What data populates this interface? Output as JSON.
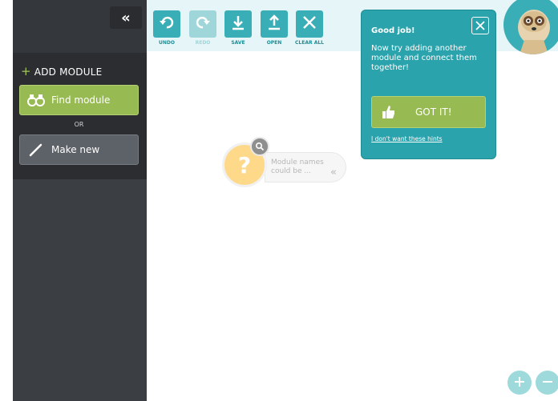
{
  "sidebar": {
    "collapse_icon": "double-chevron-left-icon",
    "add_module_label": "ADD MODULE",
    "find_module_label": "Find module",
    "or_label": "OR",
    "make_new_label": "Make new"
  },
  "toolbar": {
    "undo_label": "UNDO",
    "redo_label": "REDO",
    "save_label": "SAVE",
    "open_label": "OPEN",
    "clear_all_label": "CLEAR ALL"
  },
  "canvas": {
    "hint_node_symbol": "?",
    "hint_text": "Module names could be ...",
    "hint_chevron": "«"
  },
  "popup": {
    "title": "Good job!",
    "body": "Now try adding another module and connect them together!",
    "got_it_label": "GOT IT!",
    "no_hints_link": "I don't want these hints"
  },
  "colors": {
    "accent_teal": "#3aaeb6",
    "accent_green": "#97bb52",
    "sidebar_dark": "#3b3e43"
  }
}
